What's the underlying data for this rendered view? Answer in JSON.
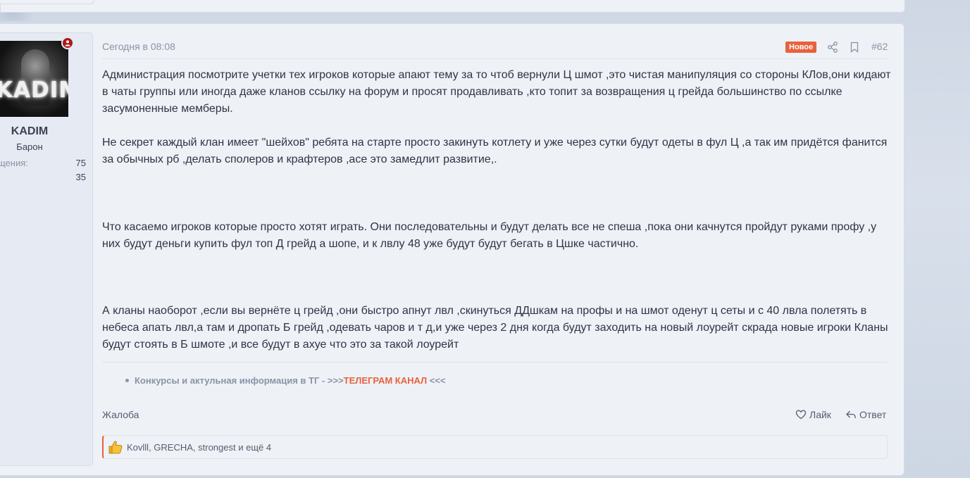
{
  "user": {
    "avatar_text": "KADIM",
    "name": "KADIM",
    "title": "Барон",
    "stats": [
      {
        "label": "щения:",
        "value": "75"
      },
      {
        "label": ":",
        "value": "35"
      }
    ]
  },
  "post": {
    "date": "Сегодня в 08:08",
    "badge": "Новое",
    "number": "#62",
    "paragraphs": [
      "Администрация посмотрите учетки тех игроков которые апают тему за то чтоб вернули Ц шмот ,это чистая манипуляция со стороны КЛов,они кидают в чаты группы или иногда даже кланов ссылку на форум и просят продавливать ,кто топит за возвращения ц грейда большинство по ссылке засумоненные мемберы.",
      "Не секрет каждый клан имеет \"шейхов\" ребята на старте просто закинуть котлету и уже через сутки будут одеты в фул Ц ,а так им придётся фанится за обычных рб ,делать сполеров и крафтеров ,асе это замедлит развитие,.",
      "Что касаемо игроков которые просто хотят играть. Они последовательны и будут делать все не спеша ,пока они качнутся пройдут руками профу ,у них будут деньги купить фул топ Д грейд а шопе, и к лвлу 48 уже будут будут бегать в Цшке частично.",
      "А кланы наоборот ,если вы вернёте ц грейд ,они быстро апнут лвл ,скинуться ДДшкам на профы и на шмот оденут ц сеты и с 40 лвла полетять в небеса апать лвл,а там и дропать Б грейд ,одевать чаров и т д,и уже через 2 дня когда будут заходить на новый лоурейт скрада новые игроки Кланы будут стоять в Б шмоте ,и все будут в ахуе что это за такой лоурейт"
    ],
    "signature": {
      "prefix": "Конкурсы и актульная информация в ТГ - >>>",
      "link": "ТЕЛЕГРАМ КАНАЛ",
      "suffix": " <<<"
    },
    "actions": {
      "report": "Жалоба",
      "like": "Лайк",
      "reply": "Ответ"
    },
    "reactions": "Kovlll, GRECHA, strongest и ещё 4"
  },
  "colors": {
    "accent": "#e8613d",
    "text": "#2e3445",
    "muted": "#8a93a6",
    "online": "#b01717"
  }
}
